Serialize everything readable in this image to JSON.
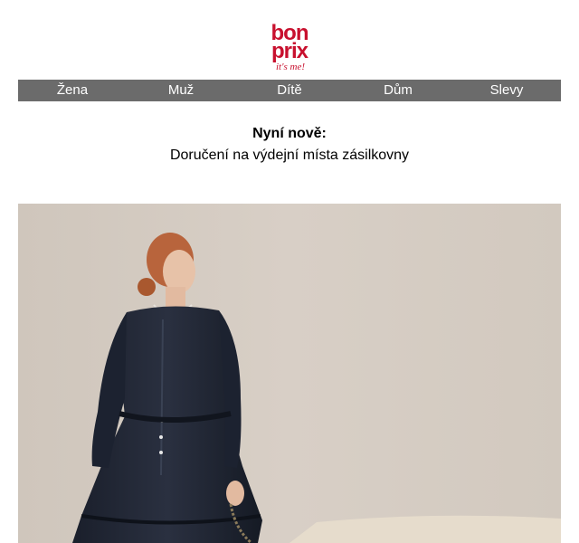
{
  "brand": {
    "logo_line1": "bon",
    "logo_line2": "prix",
    "tagline": "it's me!",
    "color": "#c8102e"
  },
  "nav": {
    "items": [
      {
        "label": "Žena"
      },
      {
        "label": "Muž"
      },
      {
        "label": "Dítě"
      },
      {
        "label": "Dům"
      },
      {
        "label": "Slevy"
      }
    ],
    "background": "#6b6b6b"
  },
  "announcement": {
    "title": "Nyní nově:",
    "text": "Doručení na výdejní místa zásilkovny"
  },
  "hero": {
    "image_alt": "woman-in-black-dress-photo"
  }
}
